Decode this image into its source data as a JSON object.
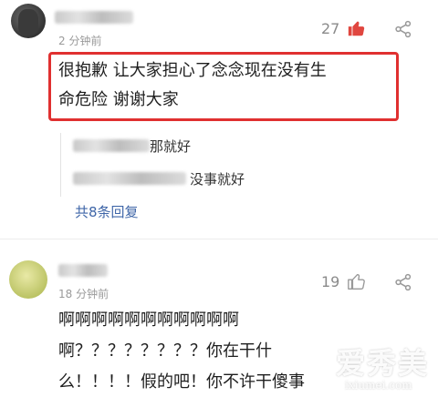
{
  "comments": [
    {
      "time": "2 分钟前",
      "likes": "27",
      "text_line1": "很抱歉 让大家担心了念念现在没有生",
      "text_line2": "命危险 谢谢大家",
      "replies": [
        {
          "text": "那就好"
        },
        {
          "text": "没事就好"
        }
      ],
      "more_replies": "共8条回复"
    },
    {
      "time": "18 分钟前",
      "likes": "19",
      "text_line1": "啊啊啊啊啊啊啊啊啊啊啊",
      "text_line2": "啊？？？？？？？？你在干什",
      "text_line3": "么！！！！假的吧！你不许干傻事"
    }
  ],
  "watermark": {
    "brand": "爱秀美",
    "url": "ixiumei.com"
  },
  "colors": {
    "like_icon_active": "#e0463f",
    "highlight_border": "#e03030",
    "link": "#3f66a8"
  },
  "icons": [
    "like-thumb-icon",
    "share-icon"
  ]
}
